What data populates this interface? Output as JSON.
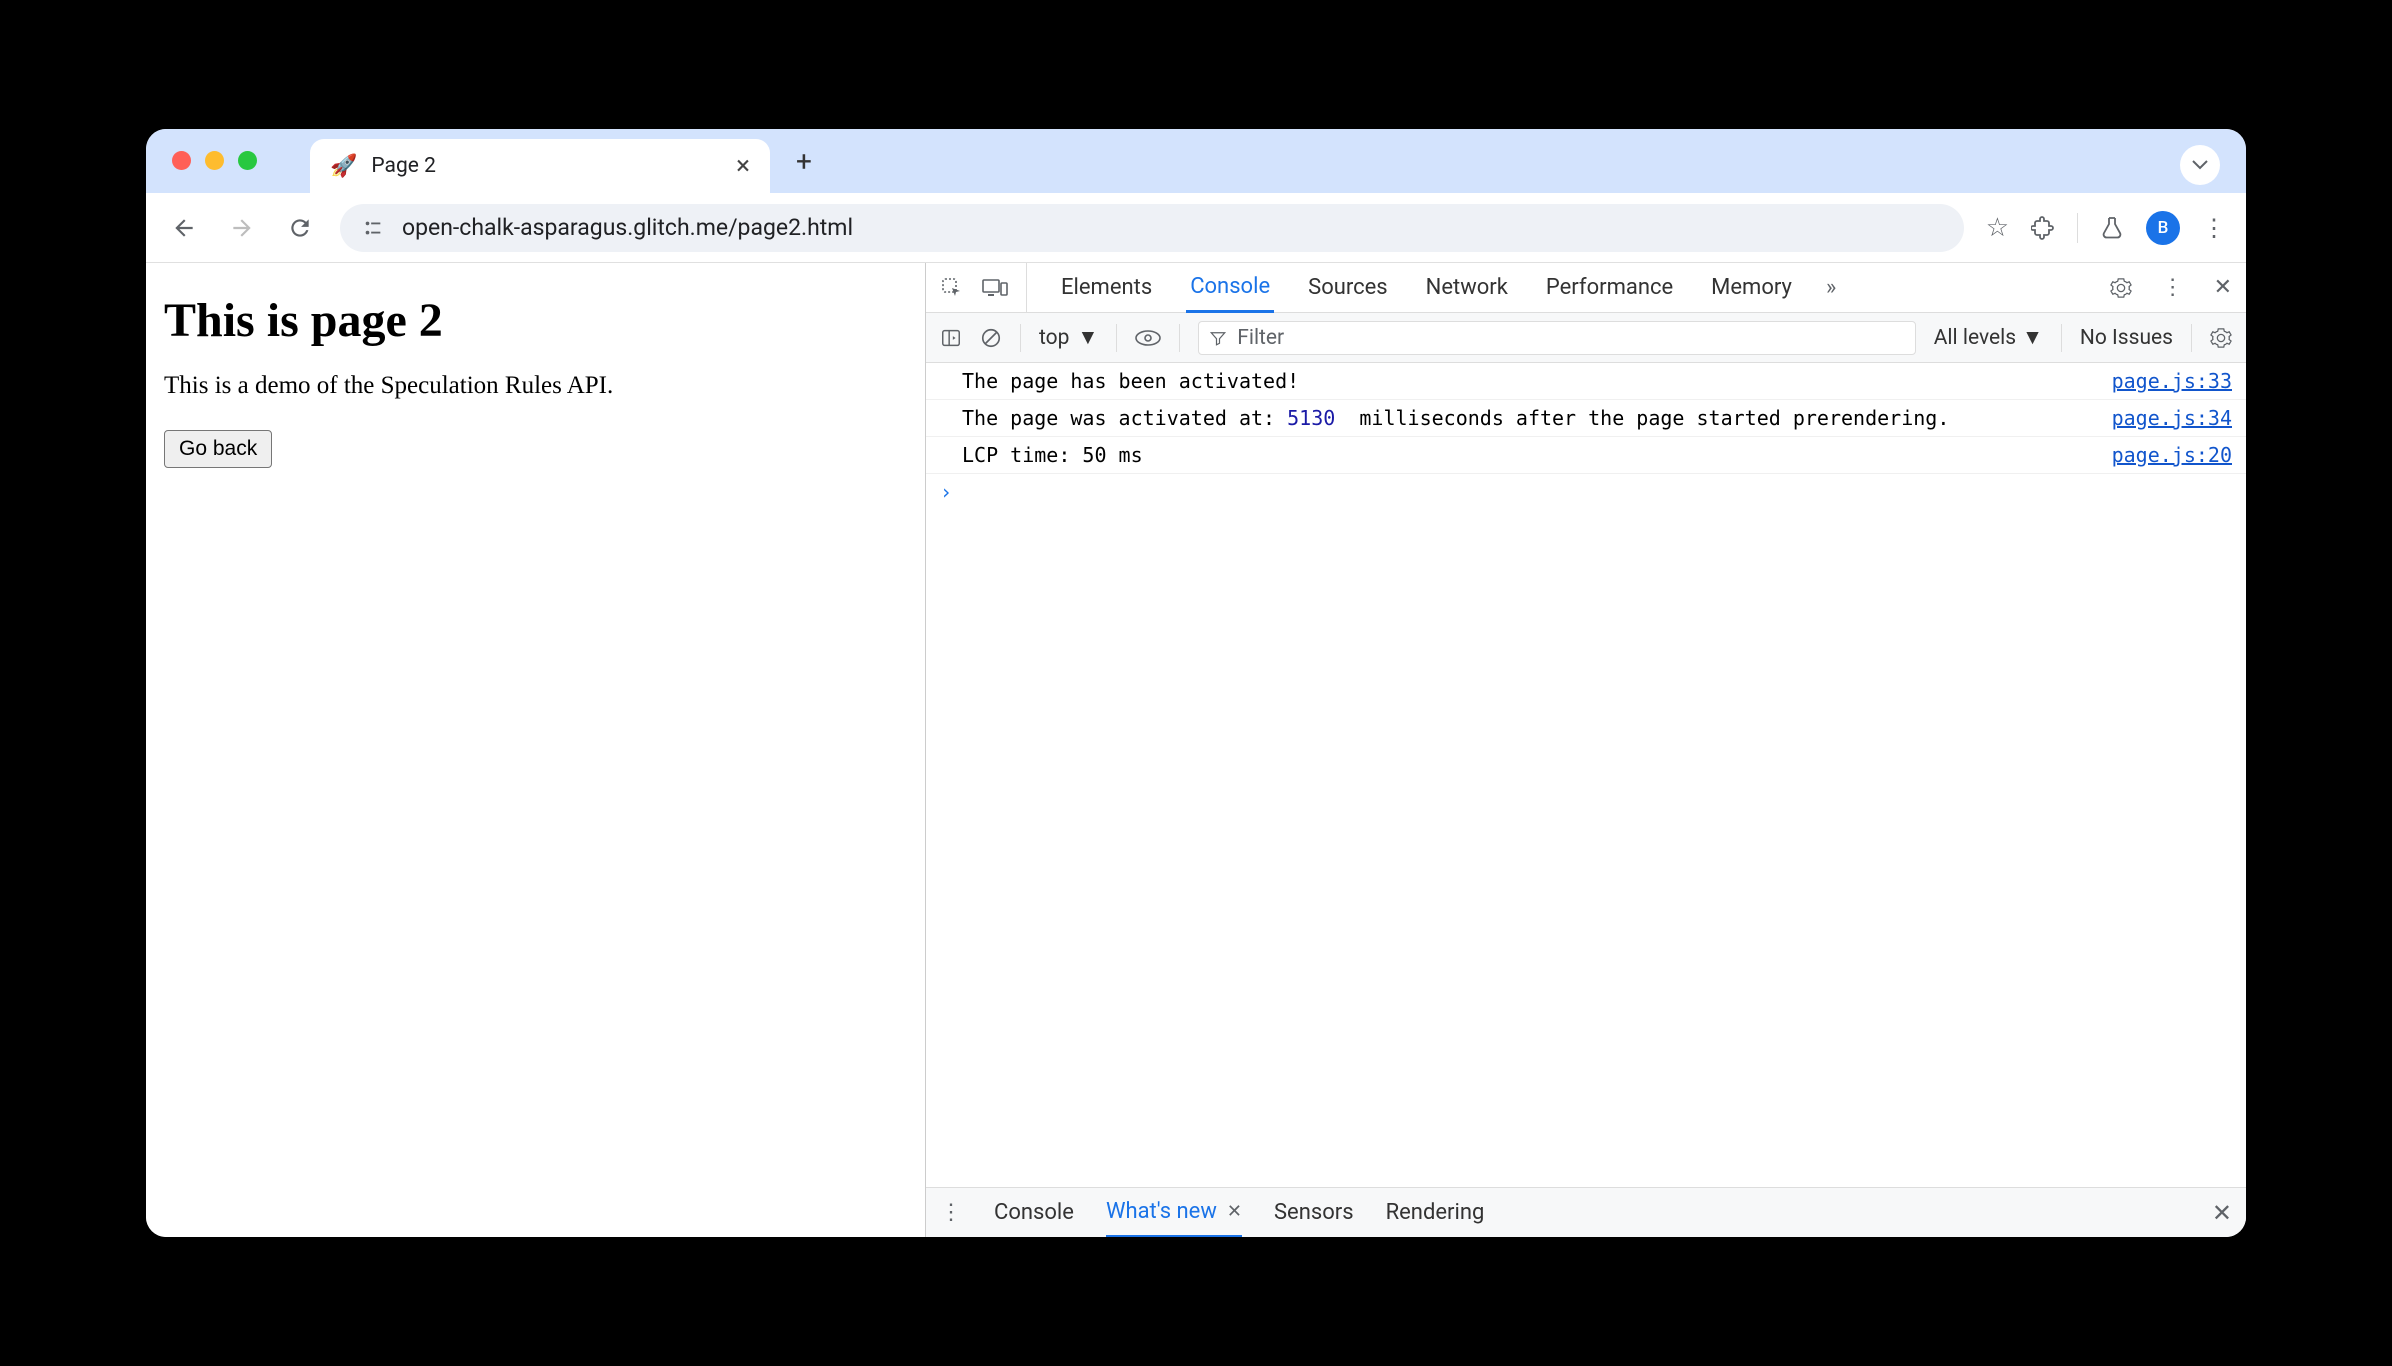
{
  "browser": {
    "tab_icon": "🚀",
    "tab_title": "Page 2",
    "url": "open-chalk-asparagus.glitch.me/page2.html",
    "avatar_letter": "B"
  },
  "page": {
    "heading": "This is page 2",
    "paragraph": "This is a demo of the Speculation Rules API.",
    "button_label": "Go back"
  },
  "devtools": {
    "tabs": [
      "Elements",
      "Console",
      "Sources",
      "Network",
      "Performance",
      "Memory"
    ],
    "active_tab": "Console",
    "filter": {
      "context": "top",
      "placeholder": "Filter",
      "levels": "All levels",
      "issues": "No Issues"
    },
    "log": [
      {
        "msg": "The page has been activated!",
        "src": "page.js:33"
      },
      {
        "msg_pre": "The page was activated at: ",
        "num": "5130",
        "msg_post": "  milliseconds after the page started prerendering.",
        "src": "page.js:34"
      },
      {
        "msg": "LCP time: 50 ms",
        "src": "page.js:20"
      }
    ],
    "drawer": {
      "tabs": [
        "Console",
        "What's new",
        "Sensors",
        "Rendering"
      ],
      "active": "What's new"
    }
  }
}
